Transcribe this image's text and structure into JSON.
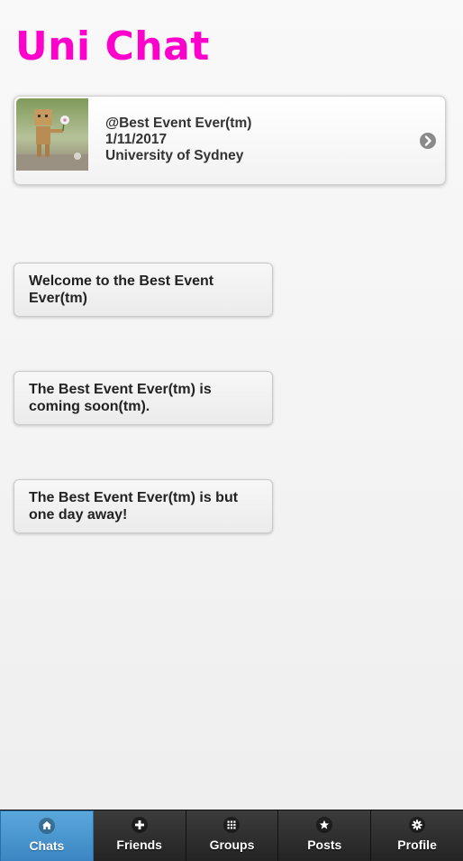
{
  "app": {
    "title": "Uni Chat"
  },
  "event": {
    "name": "@Best Event Ever(tm)",
    "date": "1/11/2017",
    "location": "University of Sydney",
    "thumbnail_icon": "danbo-figure-photo",
    "chevron_icon": "chevron-right-icon"
  },
  "messages": [
    {
      "text": "Welcome to the Best Event Ever(tm)"
    },
    {
      "text": "The Best Event Ever(tm) is coming soon(tm)."
    },
    {
      "text": "The Best Event Ever(tm) is but one day away!"
    }
  ],
  "tabs": [
    {
      "label": "Chats",
      "icon": "home-icon",
      "active": true
    },
    {
      "label": "Friends",
      "icon": "plus-icon",
      "active": false
    },
    {
      "label": "Groups",
      "icon": "grid-icon",
      "active": false
    },
    {
      "label": "Posts",
      "icon": "star-icon",
      "active": false
    },
    {
      "label": "Profile",
      "icon": "gear-icon",
      "active": false
    }
  ],
  "colors": {
    "title": "#ff00cc",
    "active_tab": "#4a98d0",
    "tabbar": "#2b2b2b"
  }
}
